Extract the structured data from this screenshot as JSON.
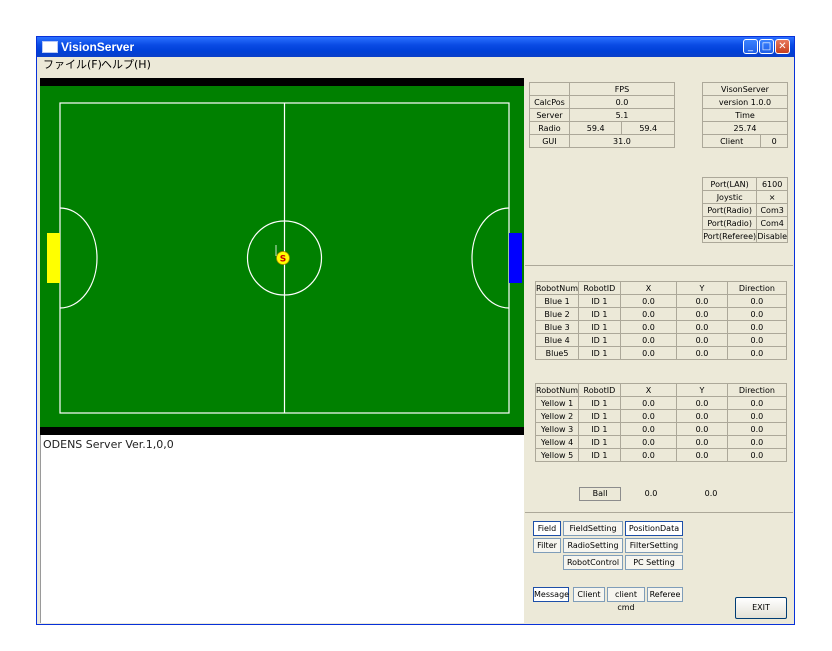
{
  "window": {
    "title": "VisionServer",
    "min": "_",
    "max": "□",
    "close": "✕"
  },
  "menu": [
    {
      "label": "ファイル(F)"
    },
    {
      "label": "ヘルプ(H)"
    }
  ],
  "field": {
    "ball_label": "S",
    "colors": {
      "field": "#008000",
      "lines": "#ffffff",
      "yellow_goal": "#ffff00",
      "blue_goal": "#0000ff"
    }
  },
  "log": {
    "text": "ODENS Server Ver.1,0,0"
  },
  "fps": {
    "title": "FPS",
    "rows": [
      {
        "label": "CalcPos",
        "values": [
          "0.0"
        ]
      },
      {
        "label": "Server",
        "values": [
          "5.1"
        ]
      },
      {
        "label": "Radio",
        "values": [
          "59.4",
          "59.4"
        ]
      },
      {
        "label": "GUI",
        "values": [
          "31.0"
        ]
      }
    ]
  },
  "server_info": {
    "name": "VisonServer",
    "version": "version 1.0.0",
    "time_label": "Time",
    "time": "25.74",
    "client_label": "Client",
    "client_count": "0"
  },
  "ports": [
    {
      "label": "Port(LAN)",
      "value": "6100"
    },
    {
      "label": "Joystic",
      "value": "×"
    },
    {
      "label": "Port(Radio)",
      "value": "Com3"
    },
    {
      "label": "Port(Radio)",
      "value": "Com4"
    },
    {
      "label": "Port(Referee)",
      "value": "Disable"
    }
  ],
  "robot_headers": [
    "RobotNum",
    "RobotID",
    "X",
    "Y",
    "Direction"
  ],
  "blue_robots": [
    {
      "num": "Blue 1",
      "id": "ID 1",
      "x": "0.0",
      "y": "0.0",
      "dir": "0.0"
    },
    {
      "num": "Blue 2",
      "id": "ID 1",
      "x": "0.0",
      "y": "0.0",
      "dir": "0.0"
    },
    {
      "num": "Blue 3",
      "id": "ID 1",
      "x": "0.0",
      "y": "0.0",
      "dir": "0.0"
    },
    {
      "num": "Blue 4",
      "id": "ID 1",
      "x": "0.0",
      "y": "0.0",
      "dir": "0.0"
    },
    {
      "num": "Blue5",
      "id": "ID 1",
      "x": "0.0",
      "y": "0.0",
      "dir": "0.0"
    }
  ],
  "yellow_robots": [
    {
      "num": "Yellow 1",
      "id": "ID 1",
      "x": "0.0",
      "y": "0.0",
      "dir": "0.0"
    },
    {
      "num": "Yellow 2",
      "id": "ID 1",
      "x": "0.0",
      "y": "0.0",
      "dir": "0.0"
    },
    {
      "num": "Yellow 3",
      "id": "ID 1",
      "x": "0.0",
      "y": "0.0",
      "dir": "0.0"
    },
    {
      "num": "Yellow 4",
      "id": "ID 1",
      "x": "0.0",
      "y": "0.0",
      "dir": "0.0"
    },
    {
      "num": "Yellow 5",
      "id": "ID 1",
      "x": "0.0",
      "y": "0.0",
      "dir": "0.0"
    }
  ],
  "ball": {
    "label": "Ball",
    "x": "0.0",
    "y": "0.0"
  },
  "buttons": {
    "field": "Field",
    "field_setting": "FieldSetting",
    "position_data": "PositionData",
    "filter": "Filter",
    "radio_setting": "RadioSetting",
    "filter_setting": "FilterSetting",
    "robot_control": "RobotControl",
    "pc_setting": "PC Setting",
    "message": "Message",
    "client": "Client",
    "client_cmd": "client cmd",
    "referee": "Referee",
    "exit": "EXIT"
  }
}
